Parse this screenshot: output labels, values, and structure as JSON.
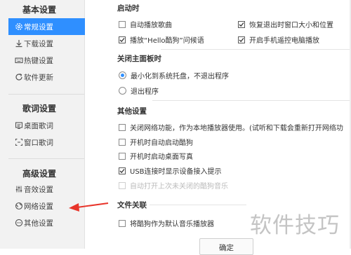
{
  "sidebar": {
    "groups": [
      {
        "title": "基本设置",
        "items": [
          {
            "label": "常规设置",
            "icon": "settings-icon",
            "active": true
          },
          {
            "label": "下载设置",
            "icon": "download-icon"
          },
          {
            "label": "热键设置",
            "icon": "keyboard-icon"
          },
          {
            "label": "软件更新",
            "icon": "update-icon"
          }
        ]
      },
      {
        "title": "歌词设置",
        "items": [
          {
            "label": "桌面歌词",
            "icon": "desktop-lyrics-icon"
          },
          {
            "label": "窗口歌词",
            "icon": "window-lyrics-icon"
          }
        ]
      },
      {
        "title": "高级设置",
        "items": [
          {
            "label": "音效设置",
            "icon": "equalizer-icon"
          },
          {
            "label": "网络设置",
            "icon": "network-icon"
          },
          {
            "label": "其他设置",
            "icon": "more-icon"
          }
        ]
      }
    ]
  },
  "main": {
    "startup": {
      "title": "启动时",
      "options": [
        {
          "label": "自动播放歌曲",
          "checked": false
        },
        {
          "label": "恢复退出时窗口大小和位置",
          "checked": true
        },
        {
          "label": "播放“Hello酷狗”问候语",
          "checked": true
        },
        {
          "label": "开启手机遥控电脑播放",
          "checked": true
        }
      ]
    },
    "close_panel": {
      "title": "关闭主面板时",
      "options": [
        {
          "label": "最小化到系统托盘，不退出程序",
          "selected": true
        },
        {
          "label": "退出程序",
          "selected": false
        }
      ]
    },
    "other": {
      "title": "其他设置",
      "options": [
        {
          "label": "关闭网络功能，作为本地播放器使用。(试听和下载会重新打开网络功",
          "checked": false
        },
        {
          "label": "开机时自动启动酷狗",
          "checked": false
        },
        {
          "label": "开机时启动桌面写真",
          "checked": false
        },
        {
          "label": "USB连接时显示设备接入提示",
          "checked": true
        },
        {
          "label": "自动打开上次未关闭的酷狗音乐",
          "checked": false,
          "disabled": true
        }
      ]
    },
    "file_assoc": {
      "title": "文件关联",
      "options": [
        {
          "label": "将酷狗作为默认音乐播放器",
          "checked": false
        }
      ]
    },
    "confirm_label": "确定"
  },
  "watermark": "软件技巧",
  "colors": {
    "accent": "#2f8fff",
    "arrow": "#e8352b"
  }
}
